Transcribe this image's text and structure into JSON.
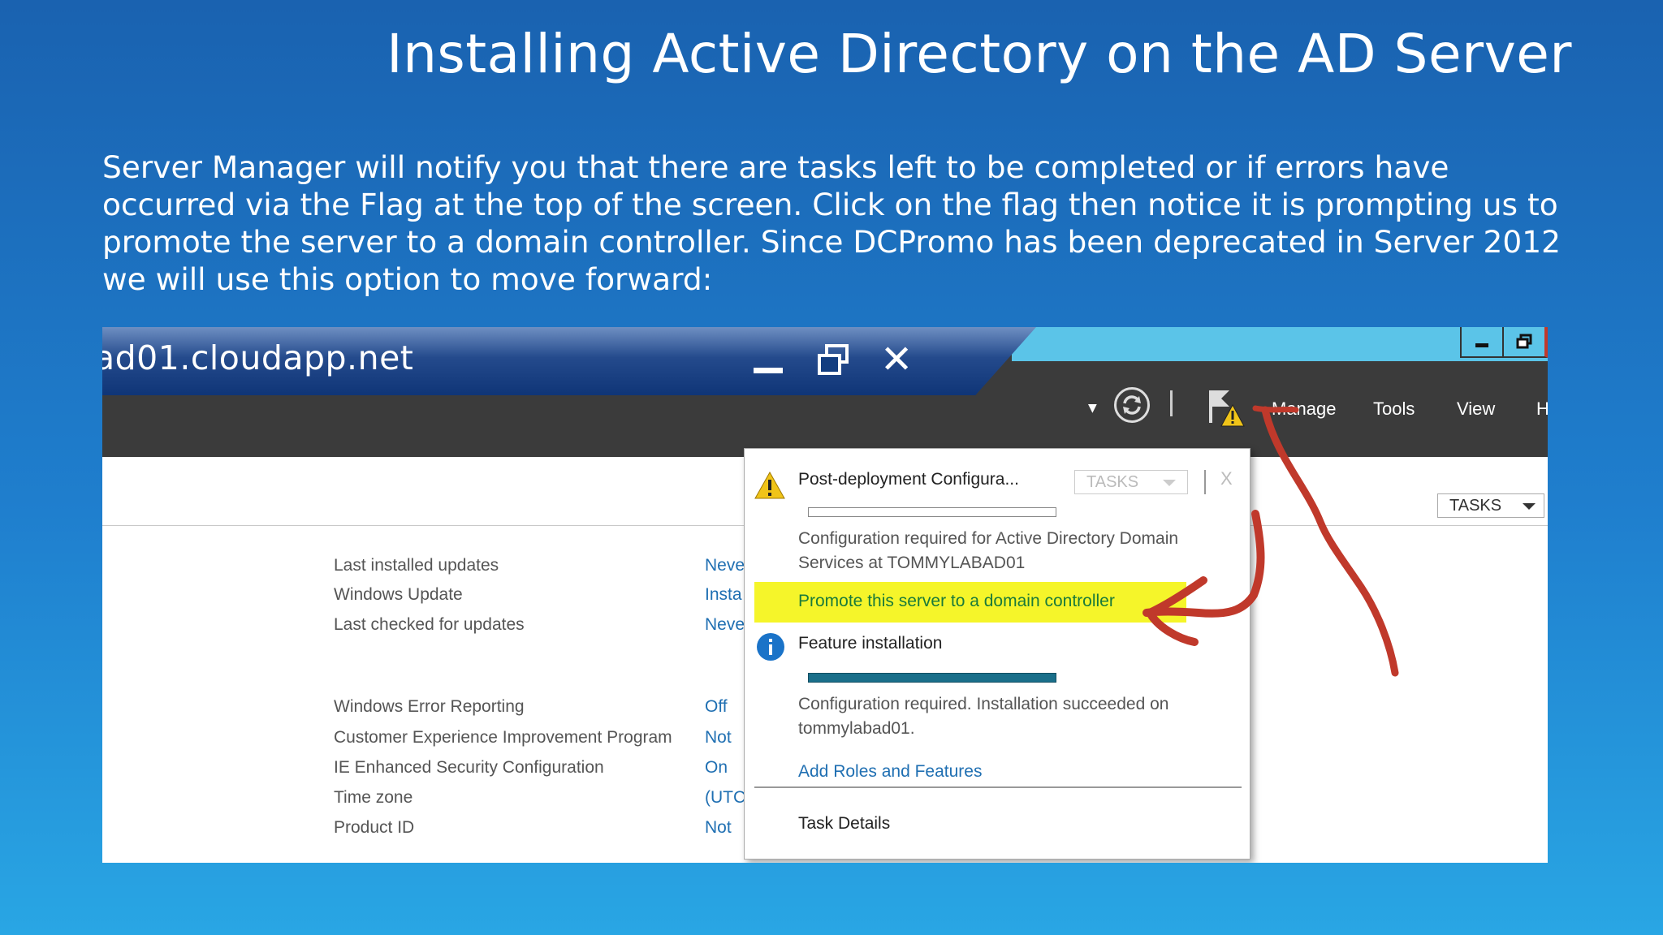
{
  "slide": {
    "title": "Installing Active Directory on the AD Server",
    "body": "Server Manager will notify you that there are tasks left to be completed or if errors have occurred via the Flag at the top of the screen.  Click on the flag then notice it is prompting us to promote the server to a domain controller.   Since DCPromo has been deprecated in Server 2012 we will use this option to move forward:"
  },
  "rdp": {
    "title": "ad01.cloudapp.net"
  },
  "header": {
    "menu": [
      "Manage",
      "Tools",
      "View",
      "H"
    ]
  },
  "content": {
    "tasks_label": "TASKS",
    "properties": [
      {
        "label": "Last installed updates",
        "value": "Neve"
      },
      {
        "label": "Windows Update",
        "value": "Insta"
      },
      {
        "label": "Last checked for updates",
        "value": "Neve"
      },
      {
        "label": "Windows Error Reporting",
        "value": "Off"
      },
      {
        "label": "Customer Experience Improvement Program",
        "value": "Not"
      },
      {
        "label": "IE Enhanced Security Configuration",
        "value": "On"
      },
      {
        "label": "Time zone",
        "value": "(UTC"
      },
      {
        "label": "Product ID",
        "value": "Not"
      }
    ]
  },
  "popup": {
    "item1": {
      "title": "Post-deployment Configura...",
      "tasks_label": "TASKS",
      "close_label": "X",
      "description": "Configuration required for Active Directory Domain Services at TOMMYLABAD01",
      "action": "Promote this server to a domain controller"
    },
    "item2": {
      "title": "Feature installation",
      "description": "Configuration required. Installation succeeded on tommylabad01.",
      "action": "Add Roles and Features"
    },
    "footer": "Task Details"
  },
  "colors": {
    "link": "#1f6fb2",
    "highlight": "#f5f52a",
    "annotation": "#c0392b",
    "warning": "#f0c419",
    "info": "#1a73c8"
  }
}
